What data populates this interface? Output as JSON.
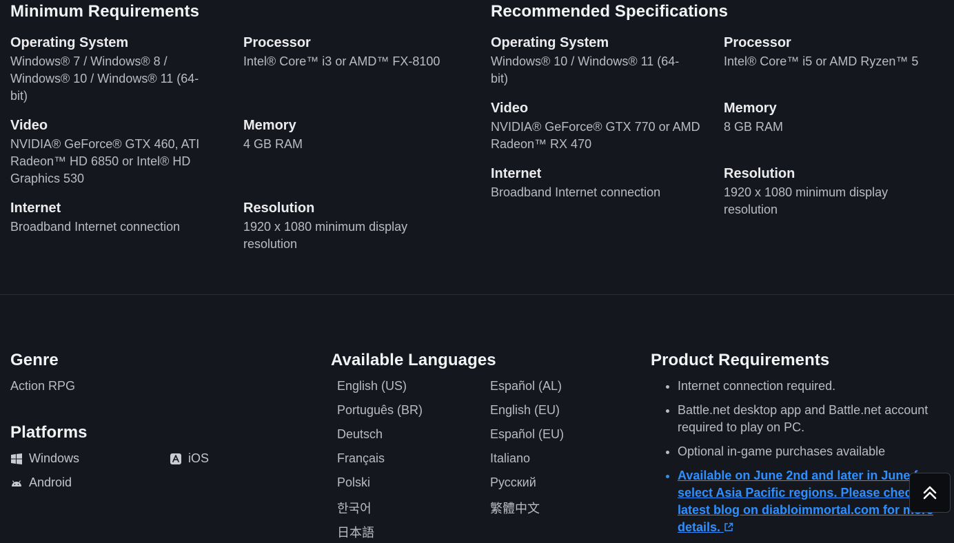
{
  "minimum": {
    "heading": "Minimum Requirements",
    "os": {
      "label": "Operating System",
      "value": "Windows® 7 / Windows® 8 / Windows® 10 / Windows® 11 (64-bit)"
    },
    "processor": {
      "label": "Processor",
      "value": "Intel® Core™ i3 or AMD™ FX-8100"
    },
    "video": {
      "label": "Video",
      "value": "NVIDIA® GeForce® GTX 460, ATI Radeon™ HD 6850 or Intel® HD Graphics 530"
    },
    "memory": {
      "label": "Memory",
      "value": "4 GB RAM"
    },
    "internet": {
      "label": "Internet",
      "value": "Broadband Internet connection"
    },
    "resolution": {
      "label": "Resolution",
      "value": "1920 x 1080 minimum display resolution"
    }
  },
  "recommended": {
    "heading": "Recommended Specifications",
    "os": {
      "label": "Operating System",
      "value": "Windows® 10 / Windows® 11 (64-bit)"
    },
    "processor": {
      "label": "Processor",
      "value": "Intel® Core™ i5 or AMD Ryzen™ 5"
    },
    "video": {
      "label": "Video",
      "value": "NVIDIA® GeForce® GTX 770 or AMD Radeon™ RX 470"
    },
    "memory": {
      "label": "Memory",
      "value": "8 GB RAM"
    },
    "internet": {
      "label": "Internet",
      "value": "Broadband Internet connection"
    },
    "resolution": {
      "label": "Resolution",
      "value": "1920 x 1080 minimum display resolution"
    }
  },
  "genre": {
    "heading": "Genre",
    "value": "Action RPG"
  },
  "platforms": {
    "heading": "Platforms",
    "items": [
      {
        "label": "Windows",
        "icon": "windows-icon"
      },
      {
        "label": "iOS",
        "icon": "app-store-icon"
      },
      {
        "label": "Android",
        "icon": "android-icon"
      }
    ]
  },
  "languages": {
    "heading": "Available Languages",
    "items": [
      "English (US)",
      "Español (AL)",
      "Português (BR)",
      "English (EU)",
      "Deutsch",
      "Español (EU)",
      "Français",
      "Italiano",
      "Polski",
      "Русский",
      "한국어",
      "繁體中文",
      "日本語"
    ]
  },
  "product_requirements": {
    "heading": "Product Requirements",
    "items": [
      "Internet connection required.",
      "Battle.net desktop app and Battle.net account required to play on PC.",
      "Optional in-game purchases available"
    ],
    "link_text": "Available on June 2nd and later in June for select Asia Pacific regions. Please check the latest blog on diabloimmortal.com for more details.",
    "link_icon": "external-link-icon"
  },
  "scroll_top": {
    "icon": "double-chevron-up-icon"
  },
  "colors": {
    "background": "#15171e",
    "link": "#2f8fff",
    "heading": "#f2f3f5",
    "text": "#b9bcc4"
  }
}
